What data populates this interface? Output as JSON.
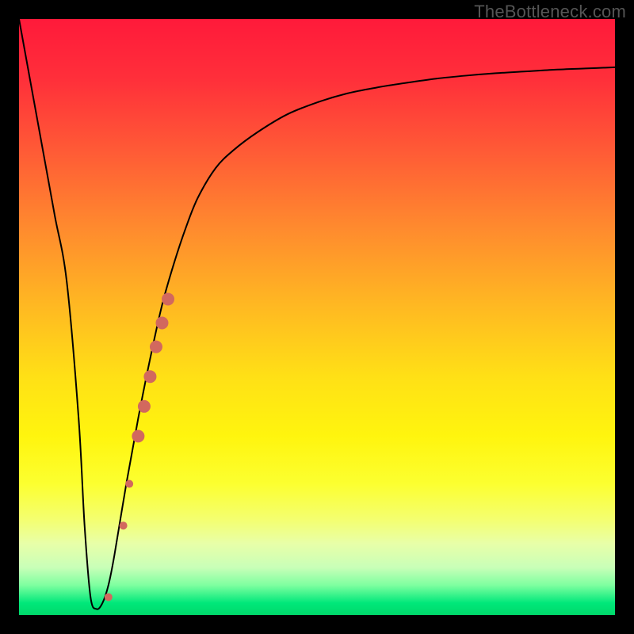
{
  "watermark": {
    "text": "TheBottleneck.com"
  },
  "chart_data": {
    "type": "line",
    "title": "",
    "xlabel": "",
    "ylabel": "",
    "xlim": [
      0,
      100
    ],
    "ylim": [
      0,
      100
    ],
    "grid": false,
    "legend": false,
    "background_gradient": {
      "direction": "vertical",
      "stops": [
        {
          "pos": 0.0,
          "color": "#ff1a3a"
        },
        {
          "pos": 0.35,
          "color": "#ff8a2e"
        },
        {
          "pos": 0.6,
          "color": "#ffe016"
        },
        {
          "pos": 0.78,
          "color": "#fcff30"
        },
        {
          "pos": 0.92,
          "color": "#c9ffb8"
        },
        {
          "pos": 1.0,
          "color": "#00d86a"
        }
      ]
    },
    "series": [
      {
        "name": "bottleneck-curve",
        "color": "#000000",
        "x": [
          0,
          2,
          4,
          6,
          8,
          10,
          11,
          12,
          13,
          14,
          15,
          16,
          18,
          20,
          22,
          24,
          26,
          28,
          30,
          33,
          36,
          40,
          45,
          50,
          55,
          60,
          65,
          70,
          75,
          80,
          85,
          90,
          95,
          100
        ],
        "y": [
          100,
          89,
          78,
          67,
          56,
          33,
          15,
          3,
          1,
          2,
          5,
          10,
          22,
          33,
          43,
          52,
          59,
          65,
          70,
          75,
          78,
          81,
          84,
          86,
          87.5,
          88.5,
          89.3,
          90,
          90.5,
          90.9,
          91.2,
          91.5,
          91.7,
          91.9
        ]
      },
      {
        "name": "highlight-points",
        "type": "scatter",
        "color": "#d2685e",
        "points": [
          {
            "x": 15.0,
            "y": 3.0,
            "r": 5
          },
          {
            "x": 17.5,
            "y": 15.0,
            "r": 5
          },
          {
            "x": 18.5,
            "y": 22.0,
            "r": 5
          },
          {
            "x": 20.0,
            "y": 30.0,
            "r": 8
          },
          {
            "x": 21.0,
            "y": 35.0,
            "r": 8
          },
          {
            "x": 22.0,
            "y": 40.0,
            "r": 8
          },
          {
            "x": 23.0,
            "y": 45.0,
            "r": 8
          },
          {
            "x": 24.0,
            "y": 49.0,
            "r": 8
          },
          {
            "x": 25.0,
            "y": 53.0,
            "r": 8
          }
        ]
      }
    ]
  }
}
